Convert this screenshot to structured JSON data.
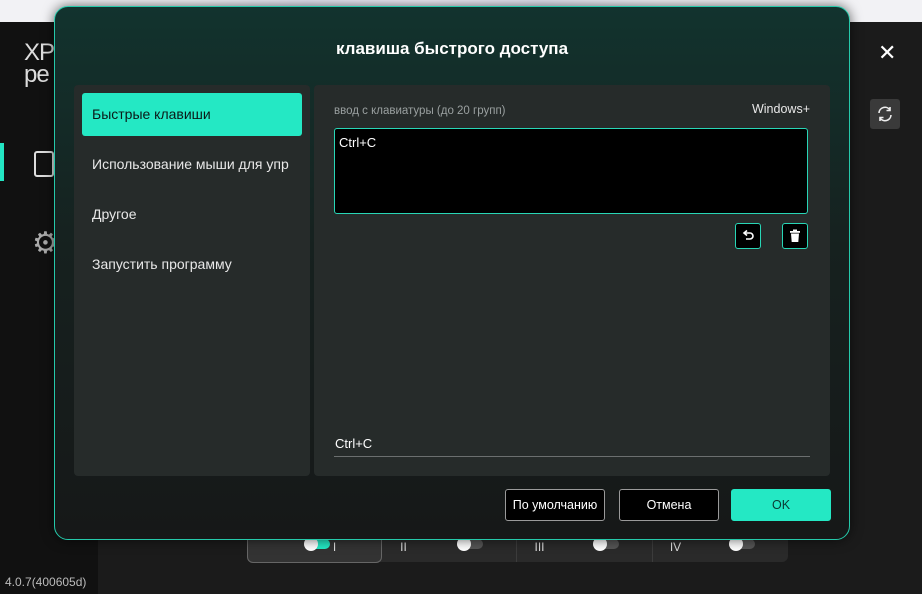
{
  "background_app": {
    "logo": "XP pen",
    "version": "4.0.7(400605d)",
    "bottom_tabs": [
      {
        "label": "I"
      },
      {
        "label": "II"
      },
      {
        "label": "III"
      },
      {
        "label": "IV"
      }
    ]
  },
  "dialog": {
    "title": "клавиша быстрого доступа",
    "nav_items": [
      {
        "label": "Быстрые клавиши",
        "active": true
      },
      {
        "label": "Использование мыши для упр",
        "active": false
      },
      {
        "label": "Другое",
        "active": false
      },
      {
        "label": "Запустить программу",
        "active": false
      }
    ],
    "keyboard_label": "ввод с клавиатуры (до 20 групп)",
    "platform": "Windows+",
    "input_value": "Ctrl+C",
    "result_value": "Ctrl+C",
    "buttons": {
      "default": "По умолчанию",
      "cancel": "Отмена",
      "ok": "OK"
    }
  },
  "colors": {
    "accent": "#24e8c4",
    "panel": "#262b2a"
  }
}
